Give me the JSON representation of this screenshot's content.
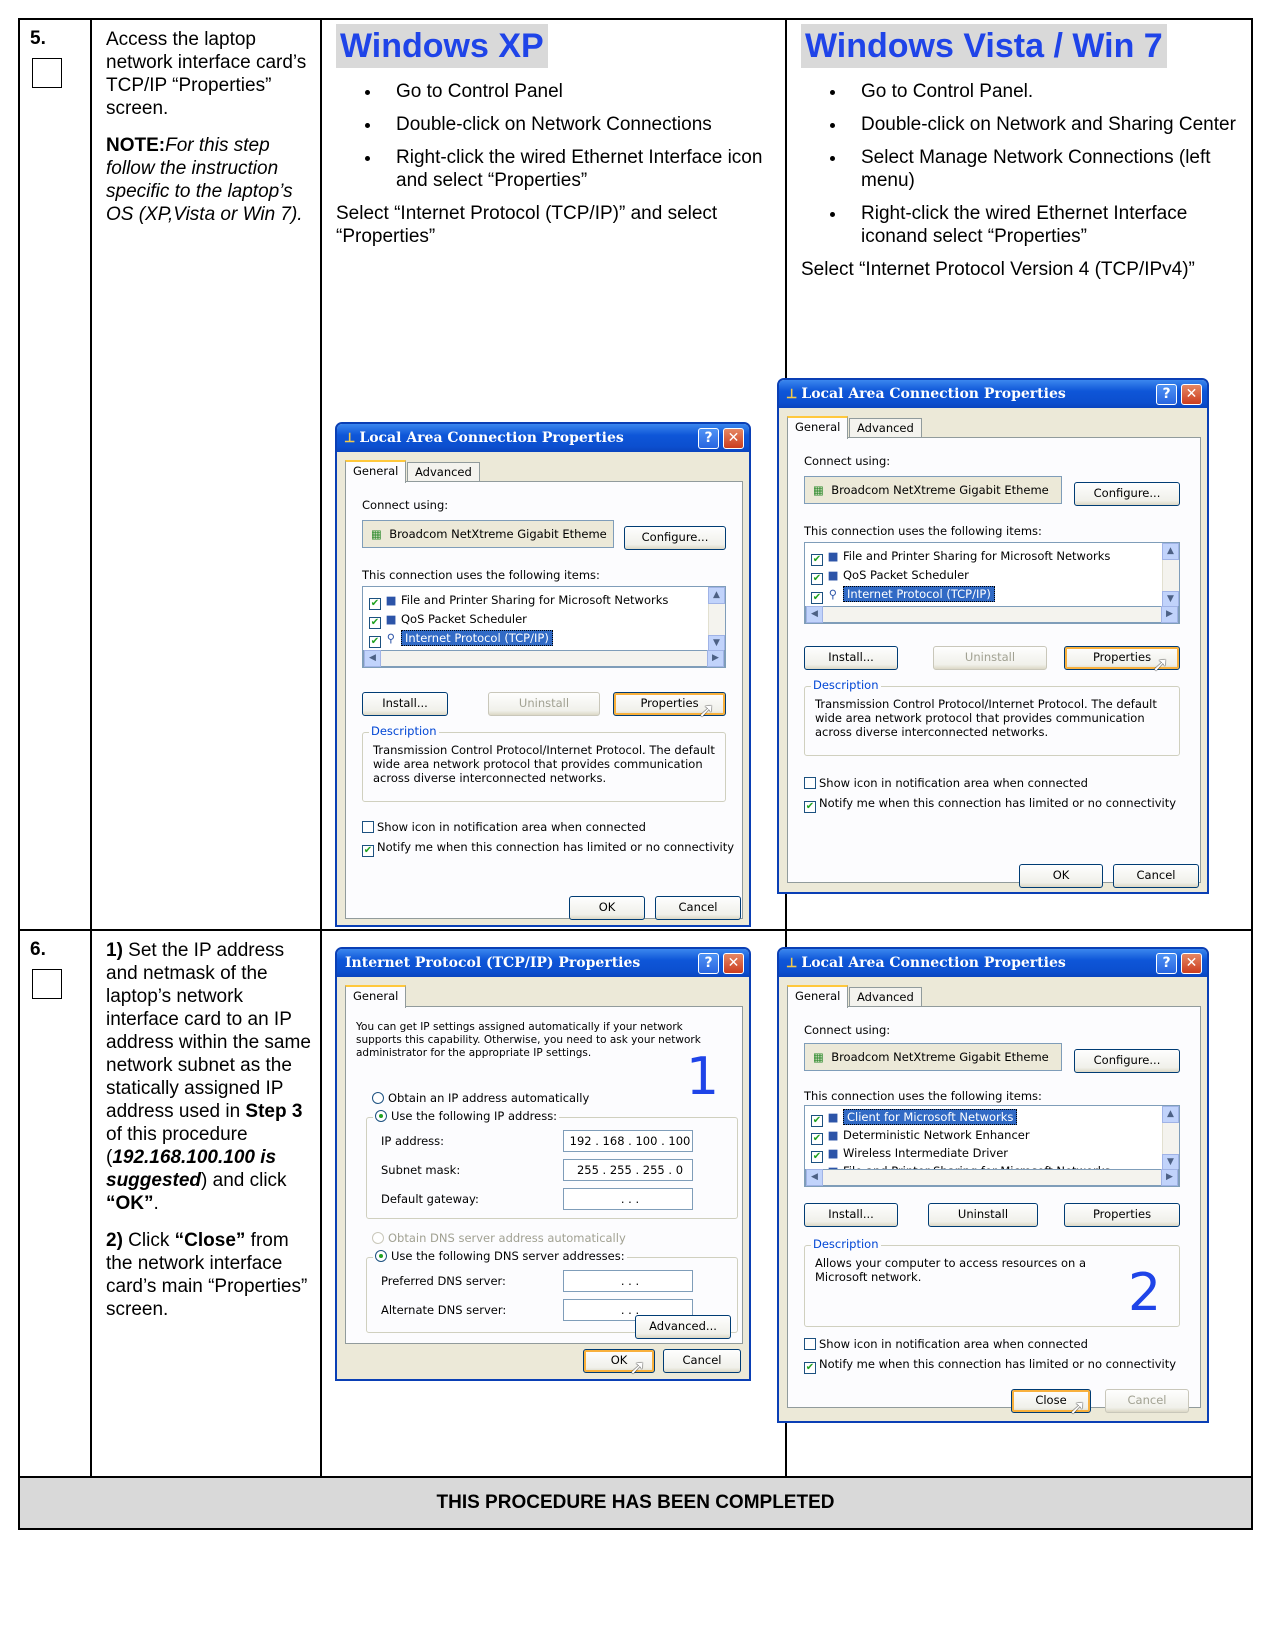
{
  "steps": [
    {
      "number": "5.",
      "description": {
        "intro": "Access the laptop network interface card’s TCP/IP “Properties” screen.",
        "note_label": "NOTE:",
        "note_text": "For this step follow the instruction specific to the laptop’s OS (XP,Vista or Win 7)."
      },
      "xp": {
        "heading": "Windows XP",
        "bullets": [
          "Go to Control Panel",
          "Double-click on  Network Connections",
          "Right-click the wired Ethernet Interface icon and select “Properties”"
        ],
        "select_note": "Select “Internet Protocol (TCP/IP)” and select “Properties”"
      },
      "vista": {
        "heading": "Windows Vista / Win 7",
        "bullets": [
          "Go to Control Panel.",
          "Double-click on  Network and Sharing Center",
          "Select Manage Network Connections (left menu)",
          "Right-click the wired Ethernet Interface iconand select “Properties”"
        ],
        "select_note": "Select “Internet Protocol Version 4 (TCP/IPv4)”"
      }
    },
    {
      "number": "6.",
      "description": {
        "p1_label": "1)",
        "p1_a": " Set the IP address and netmask of the laptop’s network interface card to an IP address within the same network subnet as the statically assigned IP address used in ",
        "p1_step": "Step 3",
        "p1_b": " of this procedure (",
        "p1_ip": "192.168.100.100 is suggested",
        "p1_c": ") and click ",
        "p1_ok": "“OK”",
        "p1_end": ".",
        "p2_label": "2)",
        "p2_a": " Click ",
        "p2_close": "“Close”",
        "p2_b": " from the network interface card’s main “Properties” screen."
      }
    }
  ],
  "lac_dialog": {
    "title": "Local Area Connection Properties",
    "help": "?",
    "close": "✕",
    "tab_general": "General",
    "tab_advanced": "Advanced",
    "connect_using": "Connect using:",
    "device": "Broadcom NetXtreme Gigabit Etheme",
    "configure": "Configure...",
    "uses_items": "This connection uses the following items:",
    "items": [
      "File and Printer Sharing for Microsoft Networks",
      "QoS Packet Scheduler",
      "Internet Protocol (TCP/IP)"
    ],
    "install": "Install...",
    "uninstall": "Uninstall",
    "properties": "Properties",
    "description_label": "Description",
    "description_text": "Transmission Control Protocol/Internet Protocol. The default wide area network protocol that provides communication across diverse interconnected networks.",
    "show_icon": "Show icon in notification area when connected",
    "notify": "Notify me when this connection has limited or no connectivity",
    "ok": "OK",
    "cancel": "Cancel"
  },
  "lac_dialog2": {
    "items": [
      "Client for Microsoft Networks",
      "Deterministic Network Enhancer",
      "Wireless Intermediate Driver",
      "File and Printer Sharing for Microsoft Networks"
    ],
    "description_text": "Allows your computer to access resources on a Microsoft network.",
    "close_btn": "Close",
    "callout": "2"
  },
  "tcpip_dialog": {
    "title": "Internet Protocol (TCP/IP) Properties",
    "tab_general": "General",
    "intro": "You can get IP settings assigned automatically if your network supports this capability. Otherwise, you need to ask your network administrator for the appropriate IP settings.",
    "obtain_ip": "Obtain an IP address automatically",
    "use_ip": "Use the following IP address:",
    "ip_label": "IP address:",
    "ip_value": "192 . 168 . 100 . 100",
    "mask_label": "Subnet mask:",
    "mask_value": "255 . 255 . 255 .  0",
    "gw_label": "Default gateway:",
    "empty_ip": ".        .        .",
    "obtain_dns": "Obtain DNS server address automatically",
    "use_dns": "Use the following DNS server addresses:",
    "pref_dns": "Preferred DNS server:",
    "alt_dns": "Alternate DNS server:",
    "advanced": "Advanced...",
    "ok": "OK",
    "cancel": "Cancel",
    "callout": "1"
  },
  "footer": "THIS PROCEDURE HAS BEEN COMPLETED",
  "colors": {
    "heading_blue": "#1f44e8",
    "heading_bg": "#d9d9d9",
    "xp_title_blue": "#0c4fcf"
  }
}
